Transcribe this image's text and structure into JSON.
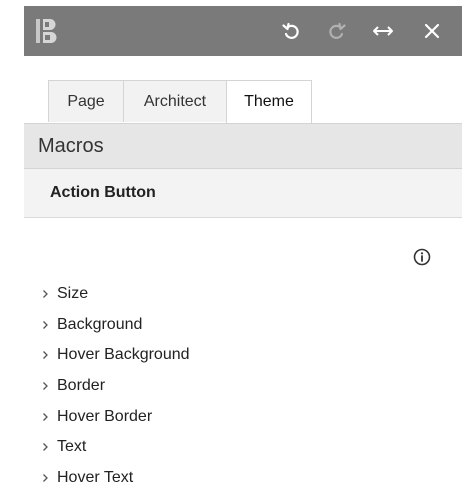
{
  "toolbar": {
    "logo_icon": "builder-logo-icon",
    "buttons": [
      {
        "name": "undo-button",
        "icon": "undo-icon"
      },
      {
        "name": "redo-button",
        "icon": "redo-icon"
      },
      {
        "name": "expand-width-button",
        "icon": "horizontal-arrows-icon"
      },
      {
        "name": "close-button",
        "icon": "close-icon"
      }
    ],
    "background_color": "#7a7a7a"
  },
  "tabs": [
    {
      "label": "Page",
      "active": false
    },
    {
      "label": "Architect",
      "active": false
    },
    {
      "label": "Theme",
      "active": true
    }
  ],
  "section": {
    "title": "Macros",
    "subtitle": "Action Button"
  },
  "info_icon": "info-icon",
  "properties": [
    {
      "label": "Size"
    },
    {
      "label": "Background"
    },
    {
      "label": "Hover Background"
    },
    {
      "label": "Border"
    },
    {
      "label": "Hover Border"
    },
    {
      "label": "Text"
    },
    {
      "label": "Hover Text"
    }
  ]
}
